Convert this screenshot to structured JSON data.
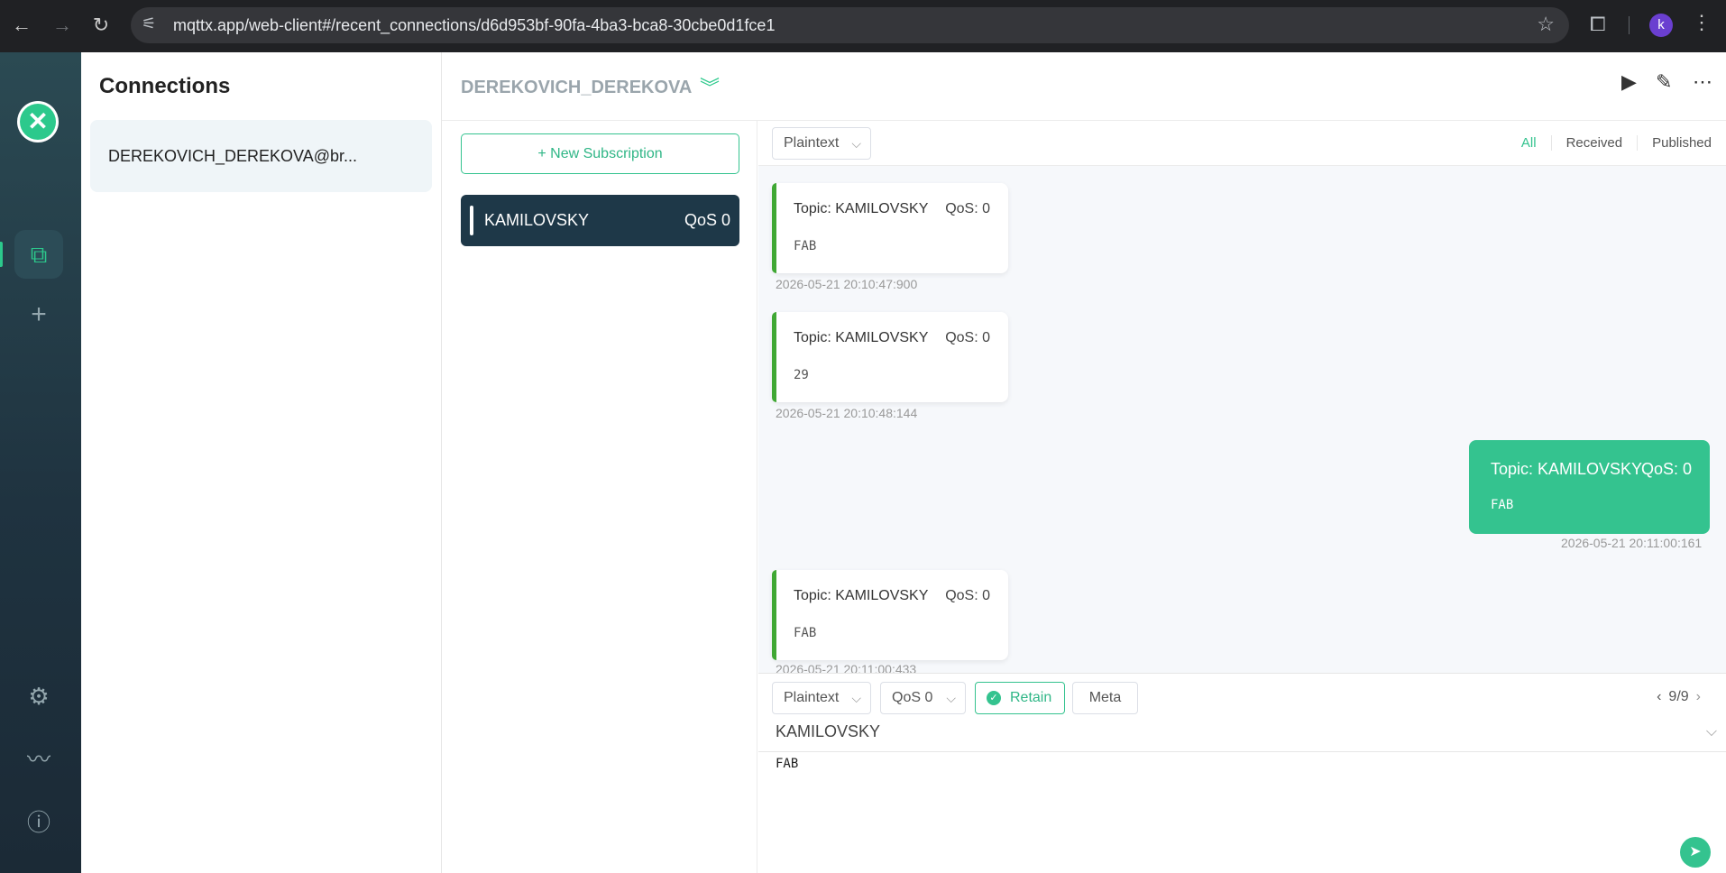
{
  "browser": {
    "url": "mqttx.app/web-client#/recent_connections/d6d953bf-90fa-4ba3-bca8-30cbe0d1fce1",
    "profile_initial": "k"
  },
  "rail": {
    "logo_glyph": "✕",
    "items": [
      {
        "name": "connections-icon",
        "glyph": "⧉"
      },
      {
        "name": "add-icon",
        "glyph": "+"
      },
      {
        "name": "settings-icon",
        "glyph": "⚙"
      },
      {
        "name": "feed-icon",
        "glyph": "〰"
      },
      {
        "name": "about-icon",
        "glyph": "ⓘ"
      }
    ]
  },
  "connections": {
    "title": "Connections",
    "items": [
      {
        "label": "DEREKOVICH_DEREKOVA@br..."
      }
    ]
  },
  "header": {
    "connection_name": "DEREKOVICH_DEREKOVA",
    "collapse_glyph": "⌄"
  },
  "subscriptions": {
    "new_button": "New Subscription",
    "new_icon": "+",
    "items": [
      {
        "topic": "KAMILOVSKY",
        "qos": "QoS 0"
      }
    ]
  },
  "messages": {
    "format": "Plaintext",
    "filters": [
      "All",
      "Received",
      "Published"
    ],
    "active_filter": "All",
    "list": [
      {
        "topic": "Topic: KAMILOVSKY",
        "qos": "QoS: 0",
        "payload": "FAB",
        "time": "2026-05-21 20:10:47:900",
        "direction": "received"
      },
      {
        "topic": "Topic: KAMILOVSKY",
        "qos": "QoS: 0",
        "payload": "29",
        "time": "2026-05-21 20:10:48:144",
        "direction": "received"
      },
      {
        "topic": "Topic: KAMILOVSKY",
        "qos": "QoS: 0",
        "payload": "FAB",
        "time": "2026-05-21 20:11:00:161",
        "direction": "published"
      },
      {
        "topic": "Topic: KAMILOVSKY",
        "qos": "QoS: 0",
        "payload": "FAB",
        "time": "2026-05-21 20:11:00:433",
        "direction": "received"
      }
    ]
  },
  "composer": {
    "format": "Plaintext",
    "qos": "QoS 0",
    "retain_label": "Retain",
    "meta_label": "Meta",
    "pager": "9/9",
    "topic": "KAMILOVSKY",
    "payload": "FAB"
  },
  "colors": {
    "accent": "#34c38f",
    "received_stripe": "#40a834",
    "subscription_bg": "#1e3848"
  }
}
